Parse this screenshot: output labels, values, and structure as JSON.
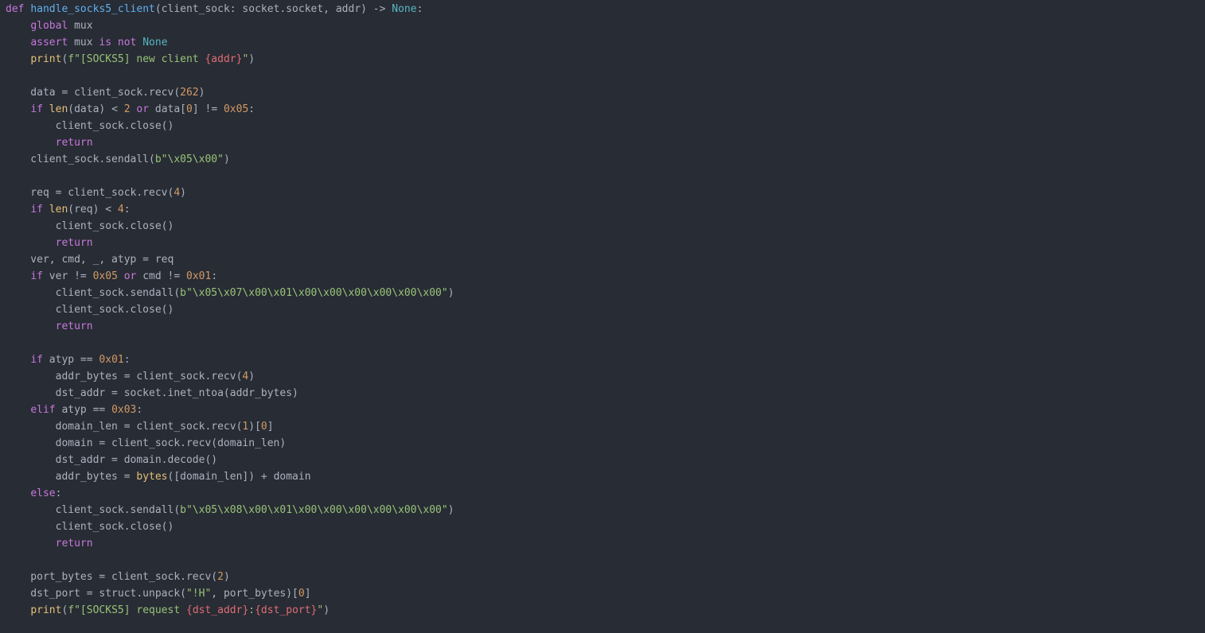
{
  "editor": {
    "language": "python",
    "theme_colors": {
      "background": "#282c34",
      "default": "#abb2bf",
      "keyword": "#c678dd",
      "function": "#61afef",
      "builtin": "#e5c07b",
      "number": "#d19a66",
      "string": "#98c379",
      "interpolation": "#e06c75",
      "constant": "#56b6c2"
    },
    "lines": [
      [
        [
          "kw",
          "def"
        ],
        [
          "pl",
          " "
        ],
        [
          "fn",
          "handle_socks5_client"
        ],
        [
          "pl",
          "(client_sock: socket.socket, addr) -> "
        ],
        [
          "cst",
          "None"
        ],
        [
          "pl",
          ":"
        ]
      ],
      [
        [
          "pl",
          "    "
        ],
        [
          "kw",
          "global"
        ],
        [
          "pl",
          " mux"
        ]
      ],
      [
        [
          "pl",
          "    "
        ],
        [
          "kw",
          "assert"
        ],
        [
          "pl",
          " mux "
        ],
        [
          "kw",
          "is not"
        ],
        [
          "pl",
          " "
        ],
        [
          "cst",
          "None"
        ]
      ],
      [
        [
          "pl",
          "    "
        ],
        [
          "bi",
          "print"
        ],
        [
          "pl",
          "("
        ],
        [
          "str",
          "f\"[SOCKS5] new client "
        ],
        [
          "ipl",
          "{addr}"
        ],
        [
          "str",
          "\""
        ],
        [
          "pl",
          ")"
        ]
      ],
      [],
      [
        [
          "pl",
          "    data = client_sock.recv("
        ],
        [
          "num",
          "262"
        ],
        [
          "pl",
          ")"
        ]
      ],
      [
        [
          "pl",
          "    "
        ],
        [
          "kw",
          "if"
        ],
        [
          "pl",
          " "
        ],
        [
          "bi",
          "len"
        ],
        [
          "pl",
          "(data) < "
        ],
        [
          "num",
          "2"
        ],
        [
          "pl",
          " "
        ],
        [
          "kw",
          "or"
        ],
        [
          "pl",
          " data["
        ],
        [
          "num",
          "0"
        ],
        [
          "pl",
          "] != "
        ],
        [
          "num",
          "0x05"
        ],
        [
          "pl",
          ":"
        ]
      ],
      [
        [
          "pl",
          "        client_sock.close()"
        ]
      ],
      [
        [
          "pl",
          "        "
        ],
        [
          "kw",
          "return"
        ]
      ],
      [
        [
          "pl",
          "    client_sock.sendall("
        ],
        [
          "str",
          "b\"\\x05\\x00\""
        ],
        [
          "pl",
          ")"
        ]
      ],
      [],
      [
        [
          "pl",
          "    req = client_sock.recv("
        ],
        [
          "num",
          "4"
        ],
        [
          "pl",
          ")"
        ]
      ],
      [
        [
          "pl",
          "    "
        ],
        [
          "kw",
          "if"
        ],
        [
          "pl",
          " "
        ],
        [
          "bi",
          "len"
        ],
        [
          "pl",
          "(req) < "
        ],
        [
          "num",
          "4"
        ],
        [
          "pl",
          ":"
        ]
      ],
      [
        [
          "pl",
          "        client_sock.close()"
        ]
      ],
      [
        [
          "pl",
          "        "
        ],
        [
          "kw",
          "return"
        ]
      ],
      [
        [
          "pl",
          "    ver, cmd, _, atyp = req"
        ]
      ],
      [
        [
          "pl",
          "    "
        ],
        [
          "kw",
          "if"
        ],
        [
          "pl",
          " ver != "
        ],
        [
          "num",
          "0x05"
        ],
        [
          "pl",
          " "
        ],
        [
          "kw",
          "or"
        ],
        [
          "pl",
          " cmd != "
        ],
        [
          "num",
          "0x01"
        ],
        [
          "pl",
          ":"
        ]
      ],
      [
        [
          "pl",
          "        client_sock.sendall("
        ],
        [
          "str",
          "b\"\\x05\\x07\\x00\\x01\\x00\\x00\\x00\\x00\\x00\\x00\""
        ],
        [
          "pl",
          ")"
        ]
      ],
      [
        [
          "pl",
          "        client_sock.close()"
        ]
      ],
      [
        [
          "pl",
          "        "
        ],
        [
          "kw",
          "return"
        ]
      ],
      [],
      [
        [
          "pl",
          "    "
        ],
        [
          "kw",
          "if"
        ],
        [
          "pl",
          " atyp == "
        ],
        [
          "num",
          "0x01"
        ],
        [
          "pl",
          ":"
        ]
      ],
      [
        [
          "pl",
          "        addr_bytes = client_sock.recv("
        ],
        [
          "num",
          "4"
        ],
        [
          "pl",
          ")"
        ]
      ],
      [
        [
          "pl",
          "        dst_addr = socket.inet_ntoa(addr_bytes)"
        ]
      ],
      [
        [
          "pl",
          "    "
        ],
        [
          "kw",
          "elif"
        ],
        [
          "pl",
          " atyp == "
        ],
        [
          "num",
          "0x03"
        ],
        [
          "pl",
          ":"
        ]
      ],
      [
        [
          "pl",
          "        domain_len = client_sock.recv("
        ],
        [
          "num",
          "1"
        ],
        [
          "pl",
          ")["
        ],
        [
          "num",
          "0"
        ],
        [
          "pl",
          "]"
        ]
      ],
      [
        [
          "pl",
          "        domain = client_sock.recv(domain_len)"
        ]
      ],
      [
        [
          "pl",
          "        dst_addr = domain.decode()"
        ]
      ],
      [
        [
          "pl",
          "        addr_bytes = "
        ],
        [
          "bi",
          "bytes"
        ],
        [
          "pl",
          "([domain_len]) + domain"
        ]
      ],
      [
        [
          "pl",
          "    "
        ],
        [
          "kw",
          "else"
        ],
        [
          "pl",
          ":"
        ]
      ],
      [
        [
          "pl",
          "        client_sock.sendall("
        ],
        [
          "str",
          "b\"\\x05\\x08\\x00\\x01\\x00\\x00\\x00\\x00\\x00\\x00\""
        ],
        [
          "pl",
          ")"
        ]
      ],
      [
        [
          "pl",
          "        client_sock.close()"
        ]
      ],
      [
        [
          "pl",
          "        "
        ],
        [
          "kw",
          "return"
        ]
      ],
      [],
      [
        [
          "pl",
          "    port_bytes = client_sock.recv("
        ],
        [
          "num",
          "2"
        ],
        [
          "pl",
          ")"
        ]
      ],
      [
        [
          "pl",
          "    dst_port = struct.unpack("
        ],
        [
          "str",
          "\"!H\""
        ],
        [
          "pl",
          ", port_bytes)["
        ],
        [
          "num",
          "0"
        ],
        [
          "pl",
          "]"
        ]
      ],
      [
        [
          "pl",
          "    "
        ],
        [
          "bi",
          "print"
        ],
        [
          "pl",
          "("
        ],
        [
          "str",
          "f\"[SOCKS5] request "
        ],
        [
          "ipl",
          "{dst_addr}"
        ],
        [
          "str",
          ":"
        ],
        [
          "ipl",
          "{dst_port}"
        ],
        [
          "str",
          "\""
        ],
        [
          "pl",
          ")"
        ]
      ]
    ]
  }
}
